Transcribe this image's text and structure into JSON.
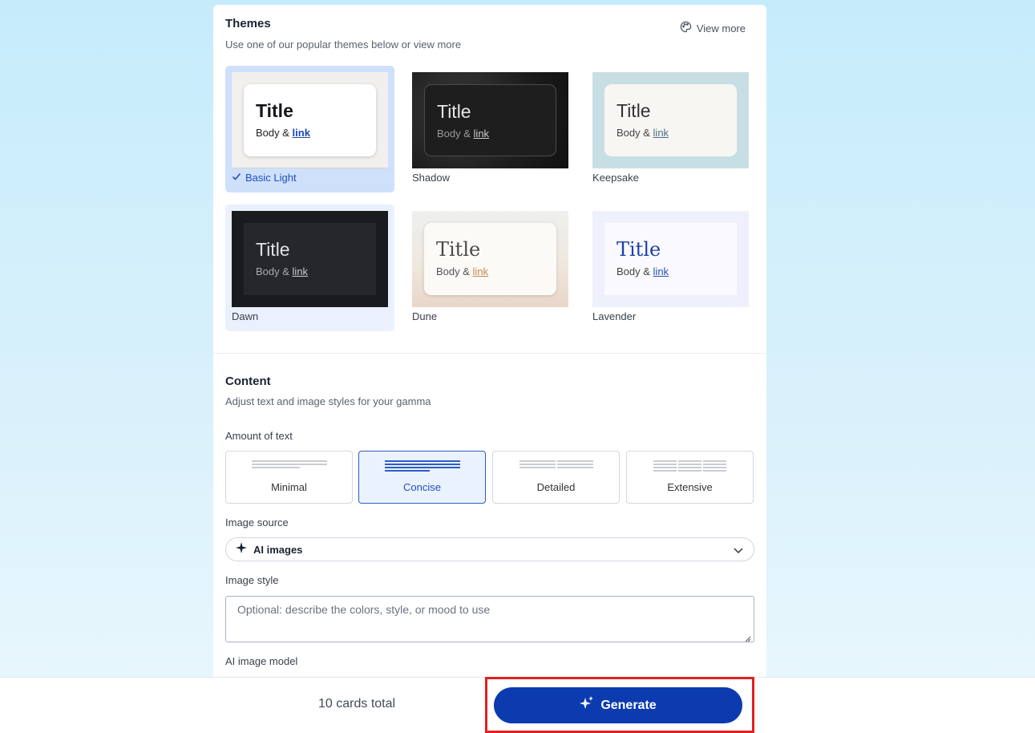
{
  "themes_section": {
    "title": "Themes",
    "subtitle": "Use one of our popular themes below or view more",
    "view_more": "View more",
    "view_more_icon": "palette-icon",
    "selected_check_icon": "check-icon",
    "items": [
      {
        "name": "Basic Light",
        "preview_title": "Title",
        "preview_body": "Body &",
        "preview_link": "link",
        "selected": true
      },
      {
        "name": "Shadow",
        "preview_title": "Title",
        "preview_body": "Body &",
        "preview_link": "link",
        "selected": false
      },
      {
        "name": "Keepsake",
        "preview_title": "Title",
        "preview_body": "Body &",
        "preview_link": "link",
        "selected": false
      },
      {
        "name": "Dawn",
        "preview_title": "Title",
        "preview_body": "Body &",
        "preview_link": "link",
        "selected": false
      },
      {
        "name": "Dune",
        "preview_title": "Title",
        "preview_body": "Body &",
        "preview_link": "link",
        "selected": false
      },
      {
        "name": "Lavender",
        "preview_title": "Title",
        "preview_body": "Body &",
        "preview_link": "link",
        "selected": false
      }
    ]
  },
  "content_section": {
    "title": "Content",
    "subtitle": "Adjust text and image styles for your gamma",
    "amount_label": "Amount of text",
    "amount_options": [
      {
        "label": "Minimal",
        "selected": false
      },
      {
        "label": "Concise",
        "selected": true
      },
      {
        "label": "Detailed",
        "selected": false
      },
      {
        "label": "Extensive",
        "selected": false
      }
    ],
    "image_source_label": "Image source",
    "image_source_value": "AI images",
    "image_source_icon": "sparkle-icon",
    "image_style_label": "Image style",
    "image_style_placeholder": "Optional: describe the colors, style, or mood to use",
    "ai_model_label": "AI image model"
  },
  "footer": {
    "cards_total": "10 cards total",
    "generate_label": "Generate",
    "generate_icon": "sparkles-icon"
  },
  "colors": {
    "accent": "#0c3bb0",
    "selected_bg": "#cfe0fb",
    "highlight_border": "#e02020"
  }
}
